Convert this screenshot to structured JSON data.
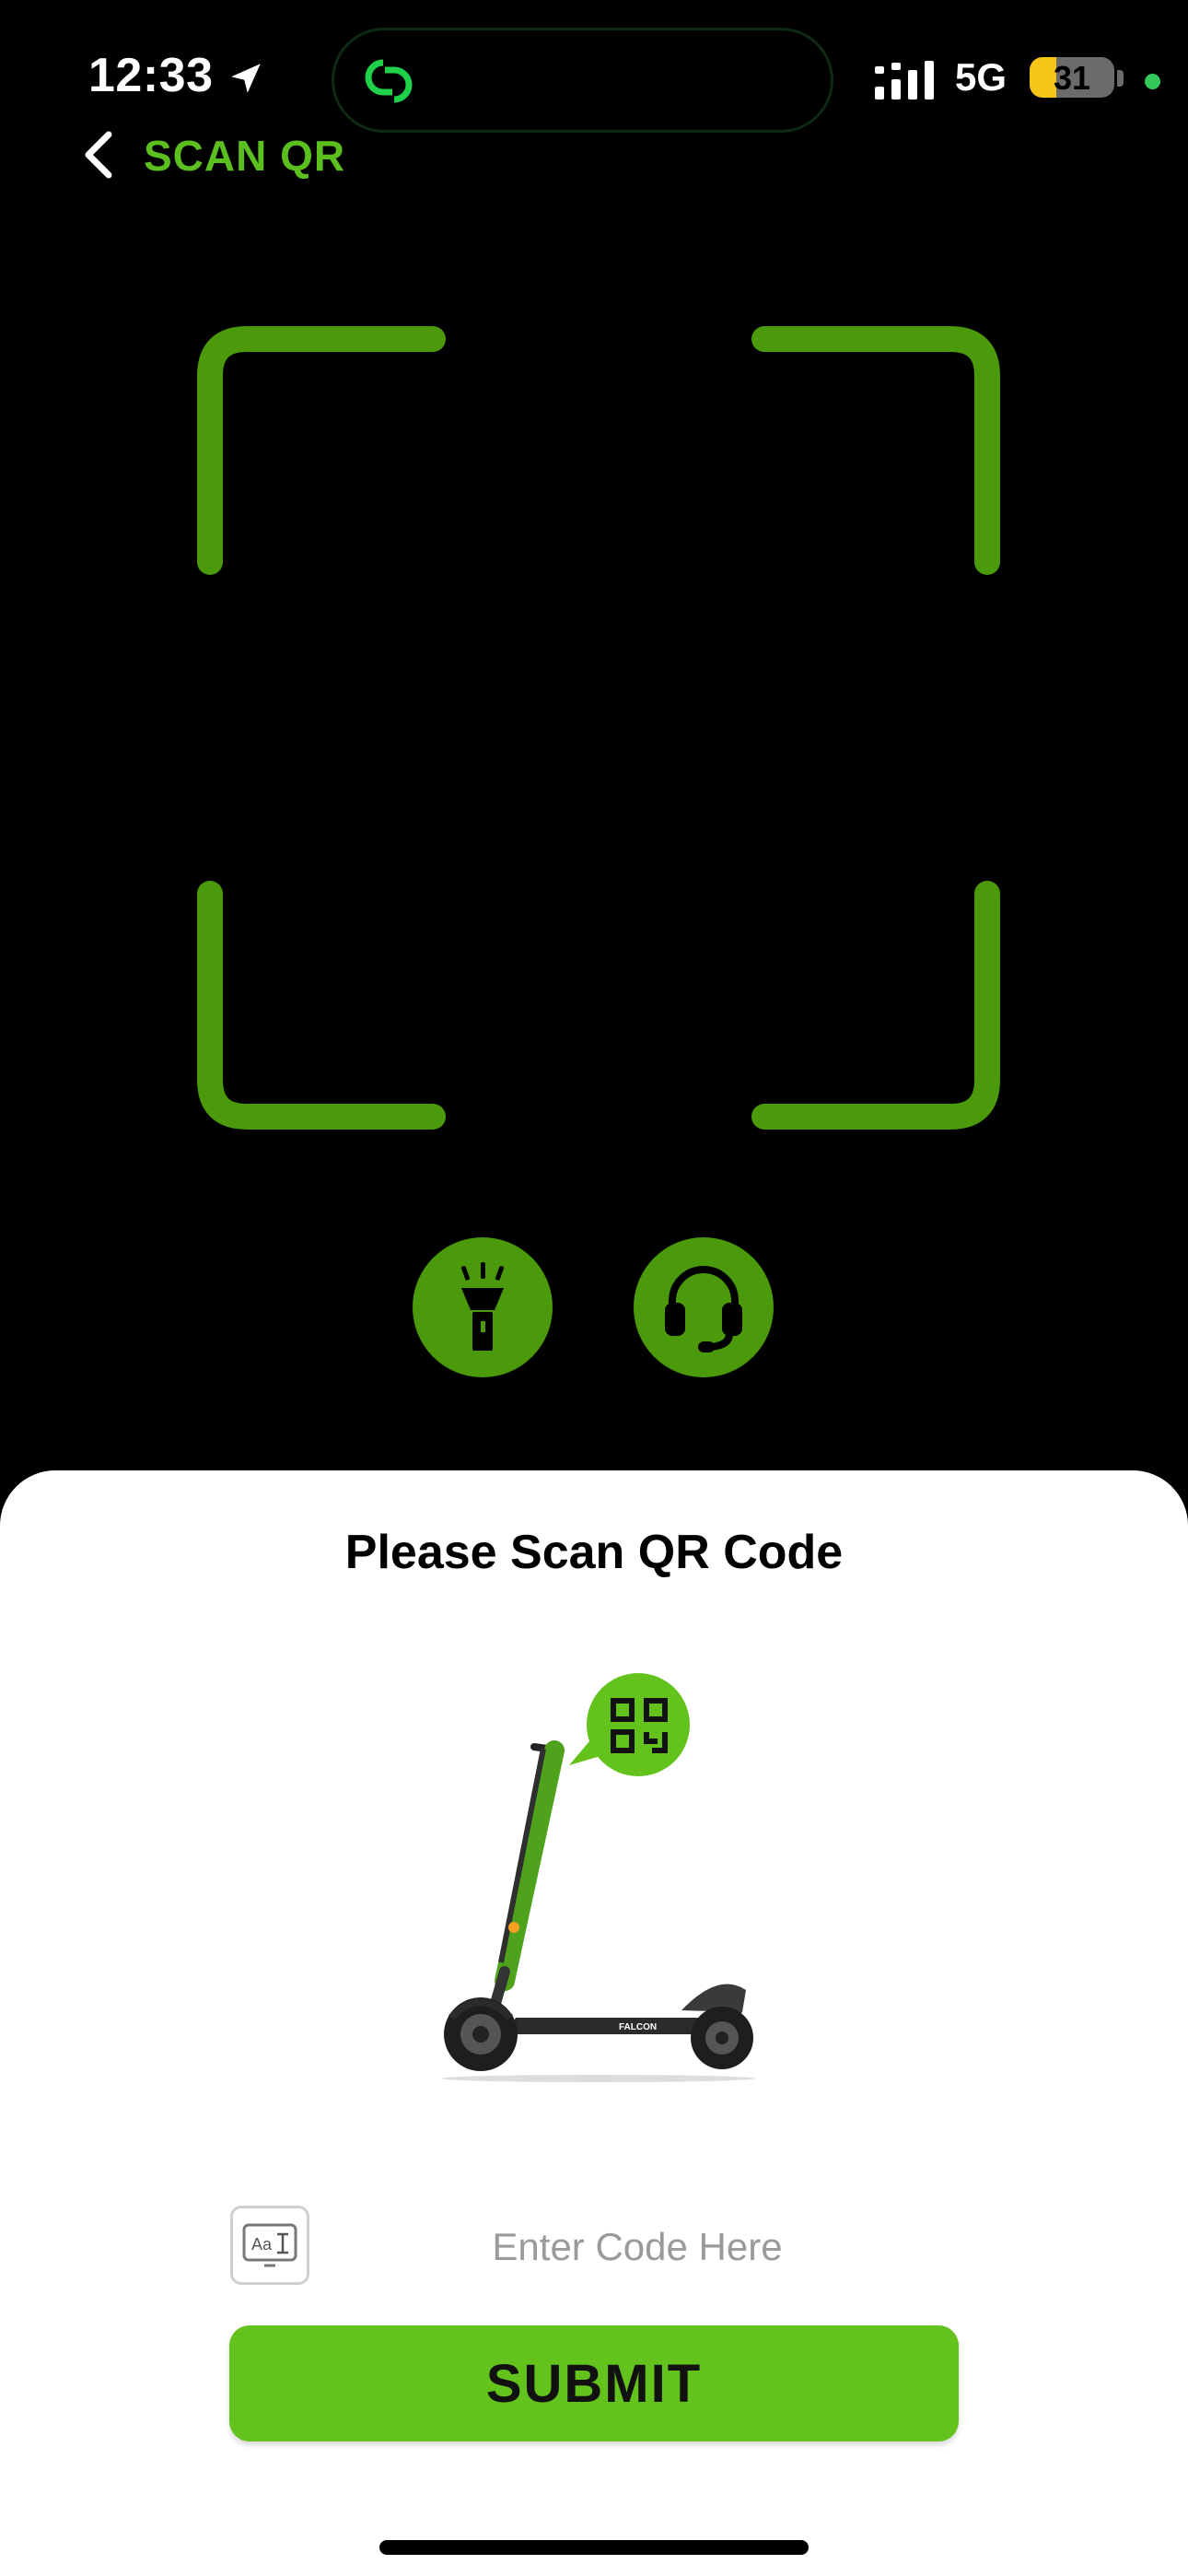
{
  "status_bar": {
    "time": "12:33",
    "network": "5G",
    "battery_level": "31",
    "battery_fraction": 0.31
  },
  "header": {
    "title": "SCAN QR"
  },
  "colors": {
    "brand_green": "#63c21c",
    "frame_green": "#4a9a0c",
    "title_green": "#5bbf1e"
  },
  "icons": {
    "flash": "flashlight-icon",
    "support": "headset-icon",
    "back": "chevron-left-icon",
    "keyboard": "keyboard-text-icon"
  },
  "sheet": {
    "title": "Please Scan QR Code",
    "code_placeholder": "Enter Code Here",
    "code_value": "",
    "submit_label": "SUBMIT",
    "scooter_brand": "FALCON"
  }
}
